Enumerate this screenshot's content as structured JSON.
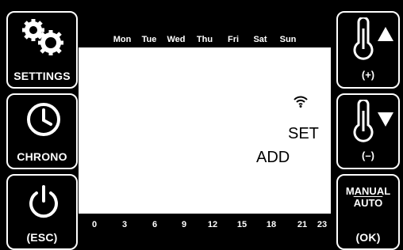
{
  "left_buttons": {
    "settings_label": "SETTINGS",
    "chrono_label": "CHRONO",
    "esc_label": "(ESC)"
  },
  "right_buttons": {
    "temp_up_label": "(+)",
    "temp_down_label": "(–)",
    "manual_label": "MANUAL",
    "auto_label": "AUTO",
    "ok_label": "(OK)"
  },
  "display": {
    "days": [
      "Mon",
      "Tue",
      "Wed",
      "Thu",
      "Fri",
      "Sat",
      "Sun"
    ],
    "hours": [
      "0",
      "3",
      "6",
      "9",
      "12",
      "15",
      "18",
      "21",
      "23"
    ],
    "set_text": "SET",
    "add_text": "ADD",
    "wifi_icon": "wifi-icon"
  },
  "colors": {
    "background": "#000000",
    "screen": "#ffffff",
    "foreground": "#ffffff"
  }
}
